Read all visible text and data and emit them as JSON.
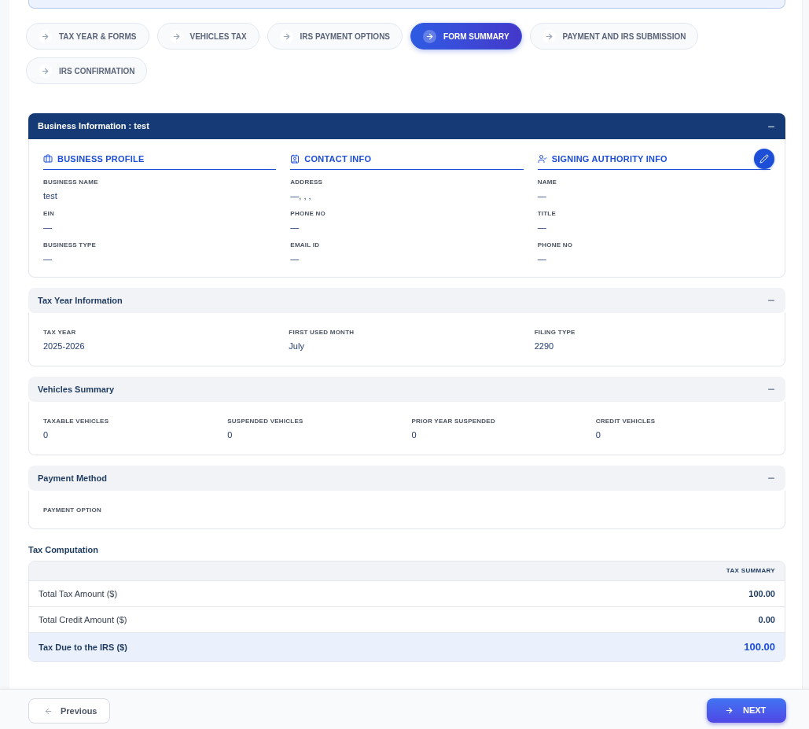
{
  "steps": [
    {
      "label": "TAX YEAR & FORMS",
      "selected": false
    },
    {
      "label": "VEHICLES TAX",
      "selected": false
    },
    {
      "label": "IRS PAYMENT OPTIONS",
      "selected": false
    },
    {
      "label": "FORM SUMMARY",
      "selected": true
    },
    {
      "label": "PAYMENT AND IRS SUBMISSION",
      "selected": false
    },
    {
      "label": "IRS CONFIRMATION",
      "selected": false
    }
  ],
  "business_information": {
    "title": "Business Information : test",
    "expanded": true,
    "groups": [
      {
        "kind": "business",
        "title": "BUSINESS PROFILE",
        "fields": [
          {
            "label": "BUSINESS NAME",
            "value": "test"
          },
          {
            "label": "EIN",
            "value": "—"
          },
          {
            "label": "BUSINESS TYPE",
            "value": "—"
          }
        ]
      },
      {
        "kind": "contact",
        "title": "CONTACT INFO",
        "fields": [
          {
            "label": "ADDRESS",
            "value": "—, , ,"
          },
          {
            "label": "PHONE NO",
            "value": "—"
          },
          {
            "label": "EMAIL ID",
            "value": "—"
          }
        ]
      },
      {
        "kind": "signing",
        "title": "SIGNING AUTHORITY INFO",
        "editable": true,
        "fields": [
          {
            "label": "NAME",
            "value": "—"
          },
          {
            "label": "TITLE",
            "value": "—"
          },
          {
            "label": "PHONE NO",
            "value": "—"
          }
        ]
      }
    ]
  },
  "sections": [
    {
      "title": "Tax Year Information",
      "expanded": true,
      "fields": [
        {
          "label": "TAX YEAR",
          "value": "2025-2026"
        },
        {
          "label": "FIRST USED MONTH",
          "value": "July"
        },
        {
          "label": "FILING TYPE",
          "value": "2290"
        }
      ]
    },
    {
      "title": "Vehicles Summary",
      "expanded": true,
      "fields": [
        {
          "label": "TAXABLE VEHICLES",
          "value": "0"
        },
        {
          "label": "SUSPENDED VEHICLES",
          "value": "0"
        },
        {
          "label": "PRIOR YEAR SUSPENDED",
          "value": "0"
        },
        {
          "label": "CREDIT VEHICLES",
          "value": "0"
        }
      ]
    },
    {
      "title": "Payment Method",
      "expanded": true,
      "fields": [
        {
          "label": "PAYMENT OPTION"
        }
      ]
    }
  ],
  "tax_computation": {
    "title": "Tax Computation",
    "column": "TAX SUMMARY",
    "rows": [
      {
        "kind": "line",
        "label": "Total Tax Amount ($)",
        "value": "100.00"
      },
      {
        "kind": "line",
        "label": "Total Credit Amount ($)",
        "value": "0.00"
      },
      {
        "kind": "total",
        "label": "Tax Due to the IRS ($)",
        "value": "100.00"
      }
    ]
  },
  "footer": {
    "previous": "Previous",
    "next": "NEXT"
  }
}
